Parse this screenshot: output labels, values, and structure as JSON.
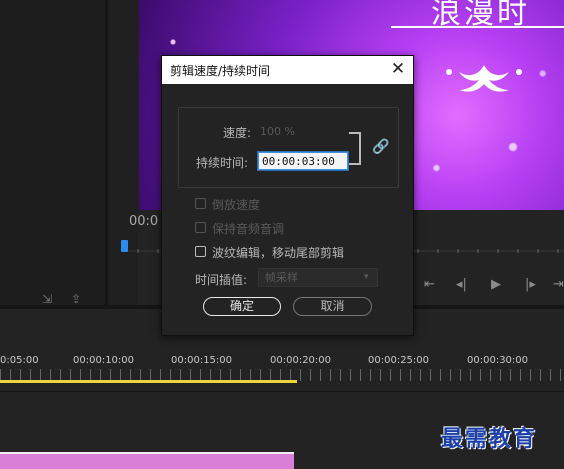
{
  "preview": {
    "title_text": "浪漫时"
  },
  "monitor": {
    "timecode_partial": "00:0",
    "controls": [
      "⇤",
      "◂|",
      "▶",
      "|▸",
      "⇥"
    ],
    "left_icons": [
      "⇲",
      "⇪"
    ]
  },
  "timeline": {
    "labels": [
      "0:05:00",
      "00:00:10:00",
      "00:00:15:00",
      "00:00:20:00",
      "00:00:25:00",
      "00:00:30:00"
    ]
  },
  "dialog": {
    "title": "剪辑速度/持续时间",
    "close_label": "✕",
    "speed_label": "速度:",
    "speed_value": "100 %",
    "duration_label": "持续时间:",
    "duration_value": "00:00:03:00",
    "checkboxes": [
      {
        "label": "倒放速度",
        "enabled": false
      },
      {
        "label": "保持音频音调",
        "enabled": false
      },
      {
        "label": "波纹编辑，移动尾部剪辑",
        "enabled": true
      }
    ],
    "interp_label": "时间插值:",
    "interp_value": "帧采样",
    "ok_label": "确定",
    "cancel_label": "取消"
  },
  "watermark": "最需教育",
  "colors": {
    "accent": "#2d8ceb",
    "timeline_bar": "#e9d33f",
    "clip": "#d97fd8",
    "watermark": "#1a3fa8"
  }
}
